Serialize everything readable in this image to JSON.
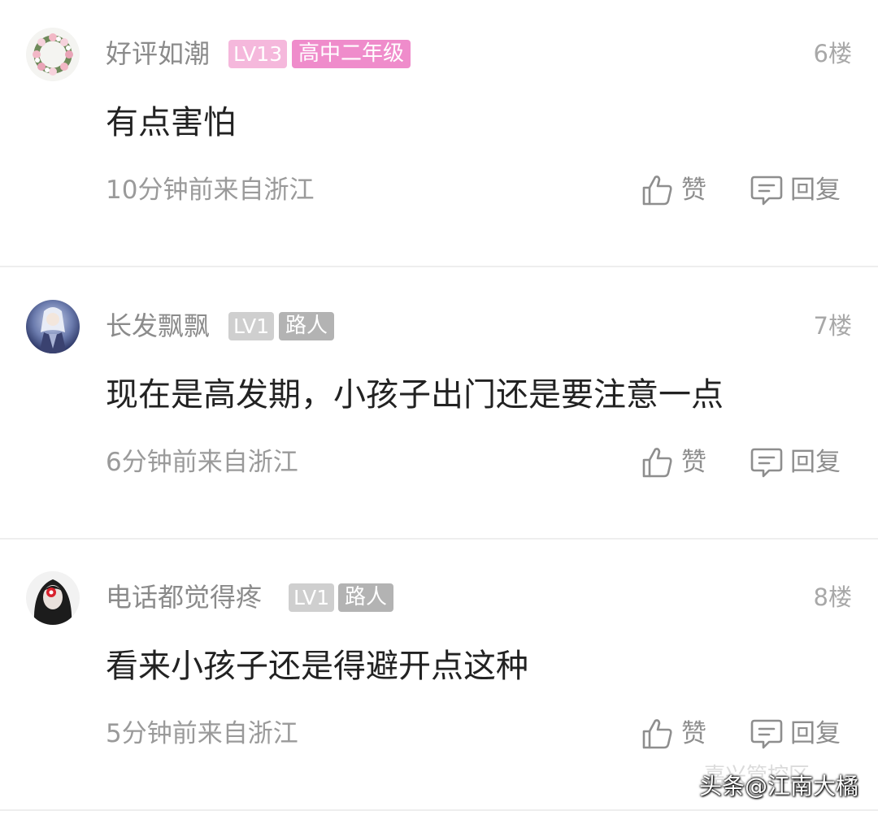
{
  "comments": [
    {
      "username": "好评如潮",
      "level": "LV13",
      "title": "高中二年级",
      "floor": "6楼",
      "content": "有点害怕",
      "meta": "10分钟前来自浙江",
      "like_label": "赞",
      "reply_label": "回复",
      "avatar_icon": "flower-wreath-avatar",
      "level_color": "#f5b8dc",
      "title_color": "#ef8ccb"
    },
    {
      "username": "长发飘飘",
      "level": "LV1",
      "title": "路人",
      "floor": "7楼",
      "content": "现在是高发期，小孩子出门还是要注意一点",
      "meta": "6分钟前来自浙江",
      "like_label": "赞",
      "reply_label": "回复",
      "avatar_icon": "anime-knight-avatar",
      "level_color": "#cfcfcf",
      "title_color": "#b3b3b3"
    },
    {
      "username": "电话都觉得疼",
      "level": "LV1",
      "title": "路人",
      "floor": "8楼",
      "content": "看来小孩子还是得避开点这种",
      "meta": "5分钟前来自浙江",
      "like_label": "赞",
      "reply_label": "回复",
      "avatar_icon": "dark-hair-girl-avatar",
      "level_color": "#cfcfcf",
      "title_color": "#b3b3b3"
    }
  ],
  "watermark": {
    "source": "头条",
    "handle": "@江南大橘",
    "faint_text": "嘉兴管控区"
  }
}
